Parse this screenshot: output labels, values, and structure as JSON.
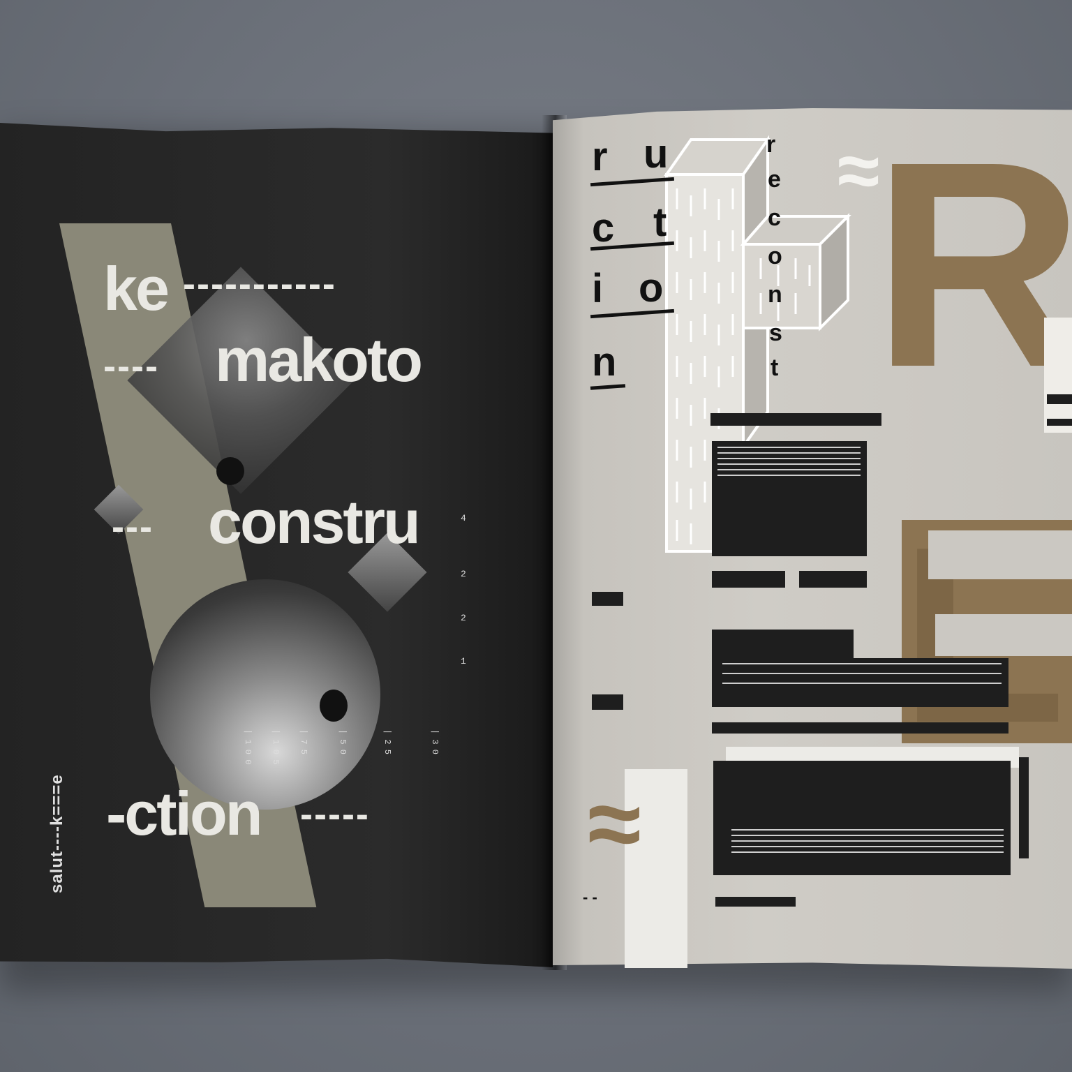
{
  "left_page": {
    "word_ke": "ke",
    "dashes_ke": "-----------",
    "dashes_makoto": "----",
    "word_makoto": "makoto",
    "dashes_constru": "---",
    "word_constru": "constru",
    "word_ction": "-ction",
    "dashes_ction": "-----",
    "side_text": "salut----k===e",
    "vertical_digits": [
      "4",
      "2",
      "2",
      "1"
    ],
    "number_columns": [
      "| 1 0 0",
      "| 1 0 5",
      "| 7 5",
      "| 5 0",
      "| 2 5",
      "| 3 0"
    ]
  },
  "right_page": {
    "vertical_letters_left": [
      "r",
      "u",
      "c",
      "t",
      "i",
      "o",
      "n"
    ],
    "vertical_letters_right": [
      "r",
      "e",
      "c",
      "o",
      "n",
      "s",
      "t"
    ],
    "big_letter_r": "R",
    "big_letter_e": "E",
    "tilde_top": "≈",
    "tilde_bottom": "≈",
    "bottom_dash": "- -"
  },
  "colors": {
    "background": "#6e737c",
    "left_page": "#262626",
    "right_page": "#cbc8c2",
    "olive": "#8a8878",
    "brown": "#8c7452",
    "black_block": "#1e1e1e"
  }
}
